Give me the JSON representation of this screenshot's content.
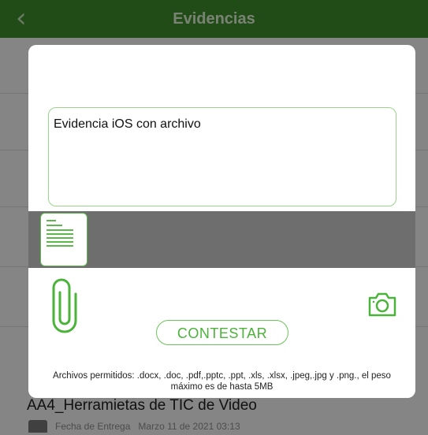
{
  "navbar": {
    "title": "Evidencias",
    "back_icon": "chevron-left-icon"
  },
  "background_list": {
    "task_title": "AA4_Herramietas de TIC de Video",
    "delivery_label": "Fecha de Entrega",
    "delivery_date": "Marzo 11 de 2021 03:13"
  },
  "modal": {
    "text_field_value": "Evidencia iOS con archivo",
    "attachments": [
      {
        "icon": "document-icon"
      }
    ],
    "attach_icon": "paperclip-icon",
    "camera_icon": "camera-icon",
    "submit_label": "CONTESTAR",
    "allowed_files_note": "Archivos permitidos: .docx, .doc, .pdf,.pptc, .ppt, .xls, .xlsx, .jpeg,.jpg y .png., el peso máximo es de hasta 5MB"
  },
  "colors": {
    "accent_green": "#4bb33a",
    "navbar_green": "#3f8a2a",
    "border_green": "#9ad48c"
  }
}
